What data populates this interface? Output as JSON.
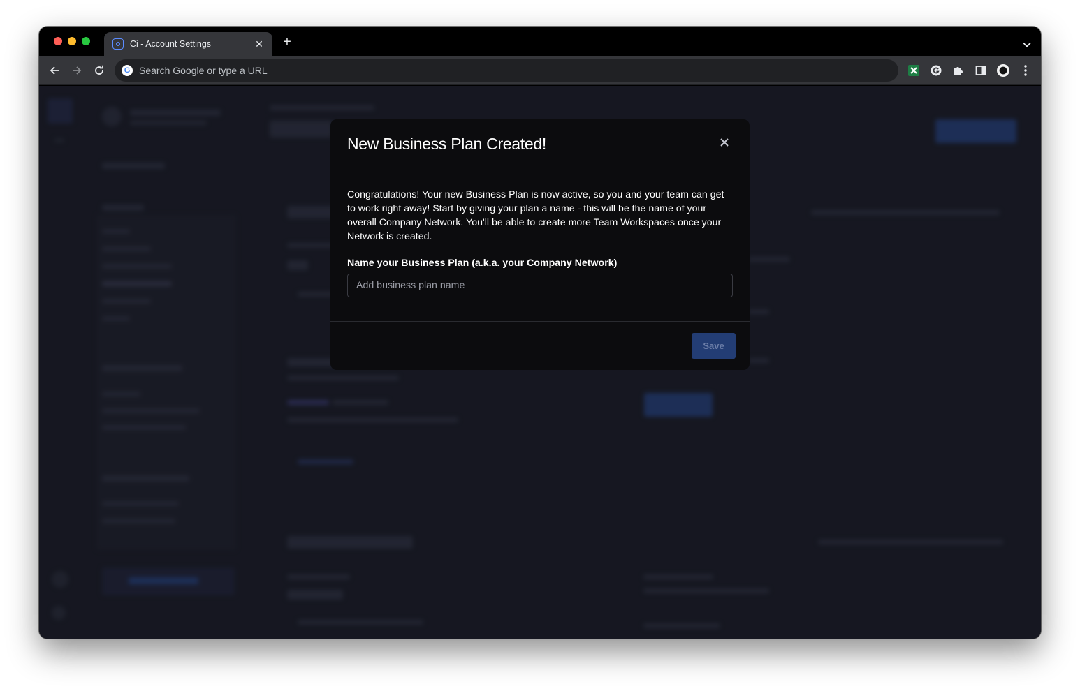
{
  "browser": {
    "tab_title": "Ci - Account Settings",
    "omnibox_placeholder": "Search Google or type a URL",
    "google_icon_letter": "G",
    "extensions": [
      "excel-extension-icon",
      "grammarly-icon",
      "puzzle-extensions-icon",
      "side-panel-icon",
      "profile-avatar"
    ]
  },
  "modal": {
    "title": "New Business Plan Created!",
    "body": "Congratulations! Your new Business Plan is now active, so you and your team can get to work right away! Start by giving your plan a name - this will be the name of your overall Company Network. You'll be able to create more Team Workspaces once your Network is created.",
    "field_label": "Name your Business Plan (a.k.a. your Company Network)",
    "field_placeholder": "Add business plan name",
    "field_value": "",
    "save_label": "Save"
  },
  "colors": {
    "page_background": "#1c1d28",
    "modal_background": "#0c0c0e",
    "save_button": "#233d74"
  }
}
